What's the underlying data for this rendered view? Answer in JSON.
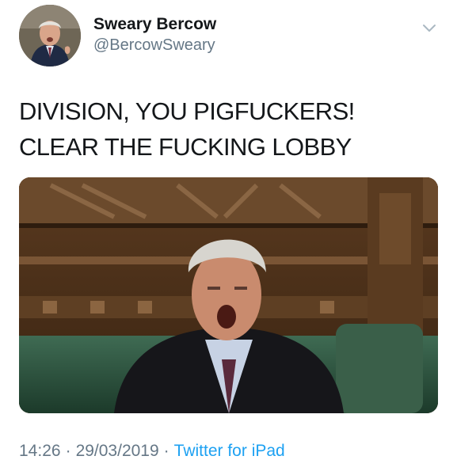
{
  "user": {
    "display_name": "Sweary Bercow",
    "handle": "@BercowSweary"
  },
  "tweet": {
    "text": "DIVISION, YOU PIGFUCKERS! CLEAR THE FUCKING LOBBY"
  },
  "meta": {
    "time": "14:26",
    "separator": "·",
    "date": "29/03/2019",
    "source": "Twitter for iPad"
  },
  "icons": {
    "more": "chevron-down-icon"
  },
  "colors": {
    "text": "#14171a",
    "secondary": "#657786",
    "link": "#1da1f2",
    "background": "#ffffff"
  }
}
